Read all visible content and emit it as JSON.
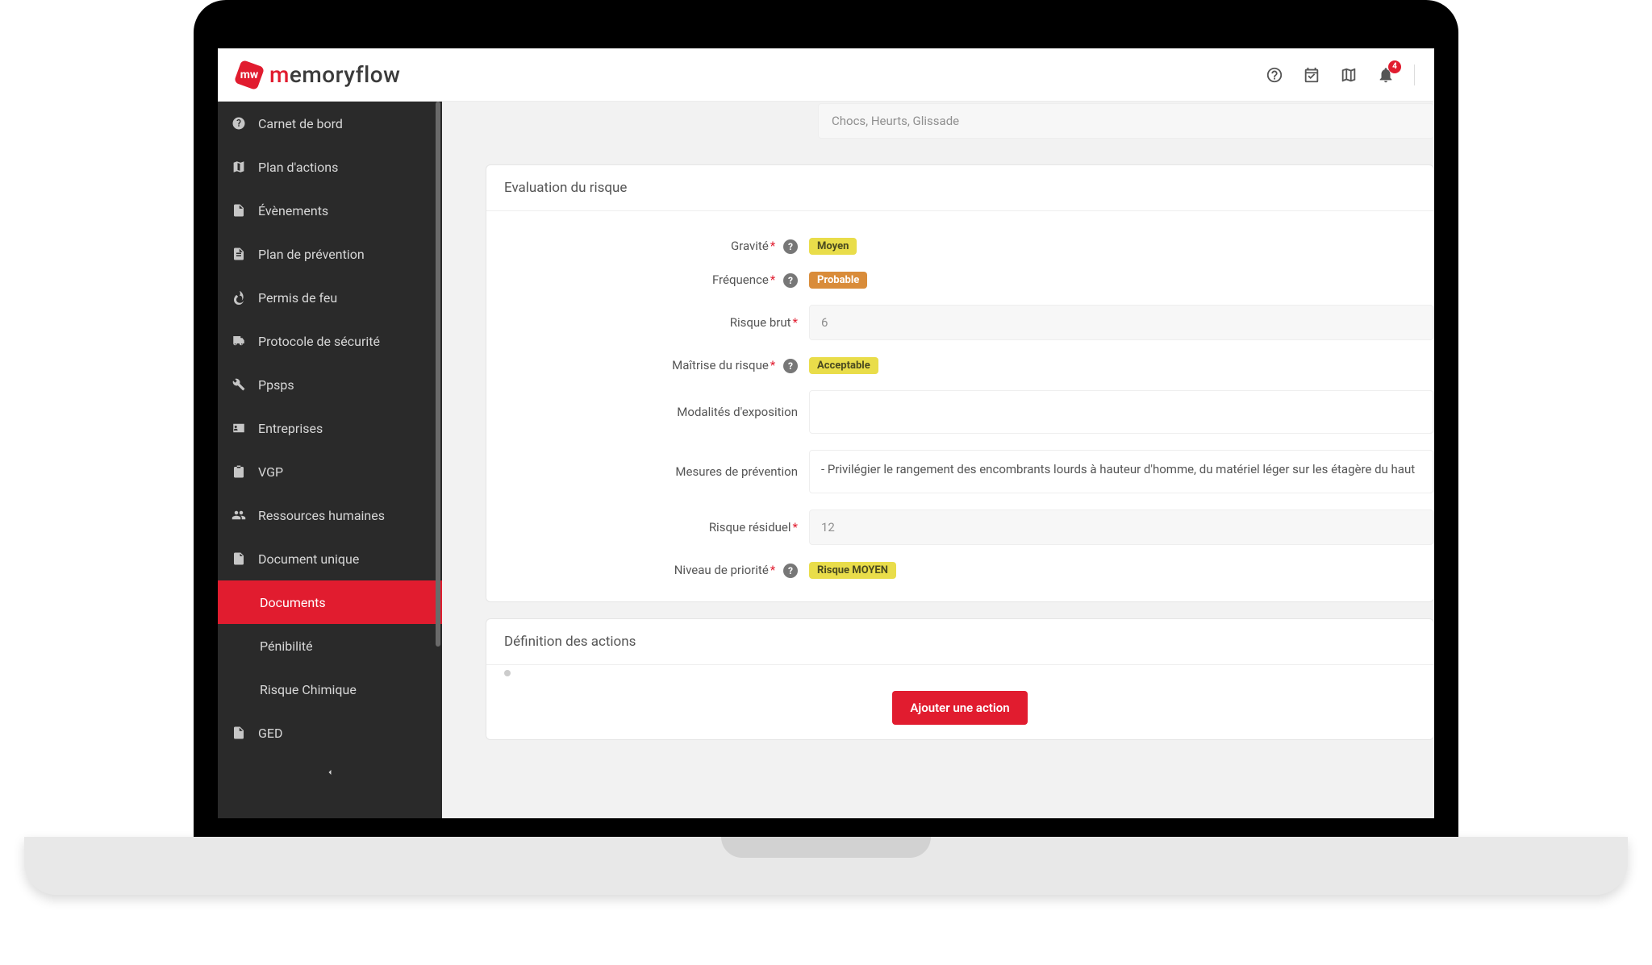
{
  "brand": {
    "prefix": "m",
    "rest": "emoryflow"
  },
  "header": {
    "notification_count": "4"
  },
  "sidebar": {
    "items": [
      {
        "label": "Carnet de bord"
      },
      {
        "label": "Plan d'actions"
      },
      {
        "label": "Évènements"
      },
      {
        "label": "Plan de prévention"
      },
      {
        "label": "Permis de feu"
      },
      {
        "label": "Protocole de sécurité"
      },
      {
        "label": "Ppsps"
      },
      {
        "label": "Entreprises"
      },
      {
        "label": "VGP"
      },
      {
        "label": "Ressources humaines"
      },
      {
        "label": "Document unique"
      },
      {
        "label": "Documents"
      },
      {
        "label": "Pénibilité"
      },
      {
        "label": "Risque Chimique"
      },
      {
        "label": "GED"
      }
    ]
  },
  "top_section": {
    "value": "Chocs, Heurts, Glissade"
  },
  "section_eval": {
    "title": "Evaluation du risque",
    "rows": {
      "gravite": {
        "label": "Gravité",
        "tag": "Moyen"
      },
      "frequence": {
        "label": "Fréquence",
        "tag": "Probable"
      },
      "brut": {
        "label": "Risque brut",
        "value": "6"
      },
      "maitrise": {
        "label": "Maîtrise du risque",
        "tag": "Acceptable"
      },
      "exposition": {
        "label": "Modalités d'exposition",
        "value": ""
      },
      "mesures": {
        "label": "Mesures de prévention",
        "value": "- Privilégier le rangement des encombrants lourds à hauteur d'homme, du matériel léger sur les étagère du haut"
      },
      "residuel": {
        "label": "Risque résiduel",
        "value": "12"
      },
      "priorite": {
        "label": "Niveau de priorité",
        "tag": "Risque MOYEN"
      }
    }
  },
  "section_actions": {
    "title": "Définition des actions",
    "add_button": "Ajouter une action"
  }
}
